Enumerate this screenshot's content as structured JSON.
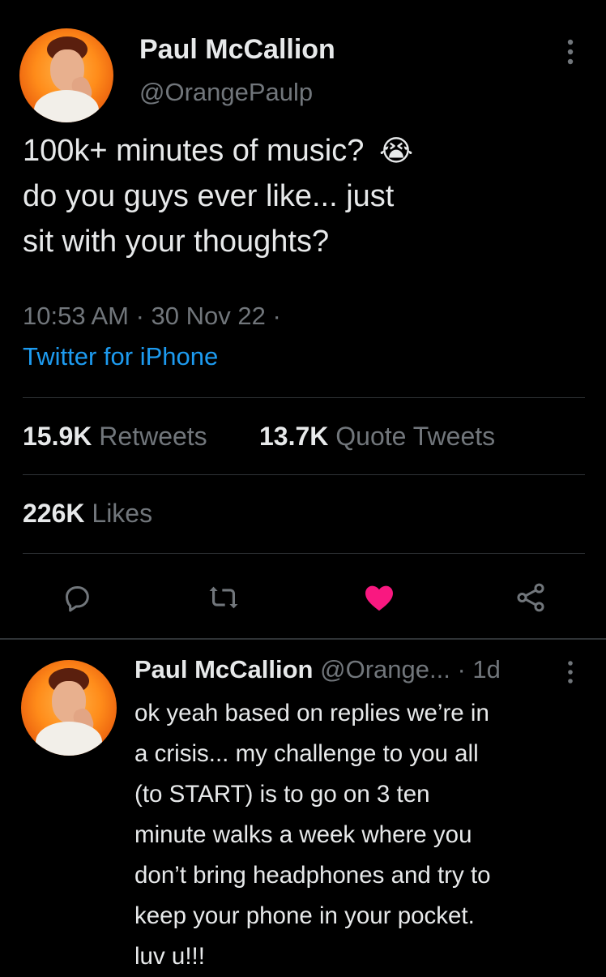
{
  "tweet": {
    "author_name": "Paul McCallion",
    "author_handle": "@OrangePaulp",
    "text_line1": "100k+ minutes of music?",
    "emoji": "😭",
    "text_line2": "do you guys ever like... just",
    "text_line3": "sit with your thoughts?",
    "timestamp": "10:53 AM · 30 Nov 22 ·",
    "source": "Twitter for iPhone",
    "retweets_count": "15.9K",
    "retweets_label": "Retweets",
    "quotes_count": "13.7K",
    "quotes_label": "Quote Tweets",
    "likes_count": "226K",
    "likes_label": "Likes"
  },
  "actions": {
    "reply_icon": "reply-icon",
    "retweet_icon": "retweet-icon",
    "like_icon": "heart-icon",
    "share_icon": "share-icon",
    "like_color": "#f91880"
  },
  "reply": {
    "author_name": "Paul McCallion",
    "author_handle": "@Orange...",
    "time": "· 1d",
    "lines": [
      "ok yeah based on replies we’re in",
      "a crisis... my challenge to you all",
      "(to START) is to go on 3 ten",
      "minute walks a week where you",
      "don’t bring headphones and try to",
      "keep your phone in your pocket.",
      "luv u!!!"
    ]
  }
}
